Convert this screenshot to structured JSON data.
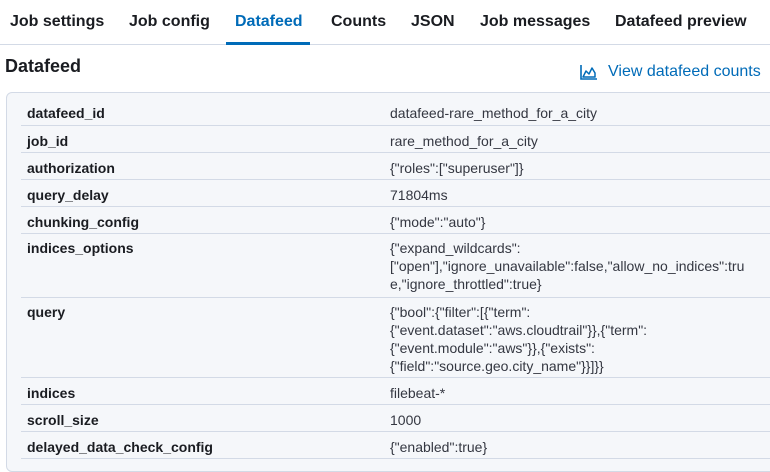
{
  "tabs": [
    {
      "label": "Job settings"
    },
    {
      "label": "Job config"
    },
    {
      "label": "Datafeed"
    },
    {
      "label": "Counts"
    },
    {
      "label": "JSON"
    },
    {
      "label": "Job messages"
    },
    {
      "label": "Datafeed preview"
    }
  ],
  "active_tab": "Datafeed",
  "section": {
    "title": "Datafeed",
    "counts_link": "View datafeed counts",
    "counts_icon": "chart-area-icon"
  },
  "colors": {
    "accent": "#006bb8",
    "panel_bg": "#f5f7fa",
    "border": "#d3dae6"
  },
  "rows": [
    {
      "key": "datafeed_id",
      "value": "datafeed-rare_method_for_a_city"
    },
    {
      "key": "job_id",
      "value": "rare_method_for_a_city"
    },
    {
      "key": "authorization",
      "value": "{\"roles\":[\"superuser\"]}"
    },
    {
      "key": "query_delay",
      "value": "71804ms"
    },
    {
      "key": "chunking_config",
      "value": "{\"mode\":\"auto\"}"
    },
    {
      "key": "indices_options",
      "value": "{\"expand_wildcards\":\n[\"open\"],\"ignore_unavailable\":false,\"allow_no_indices\":tru\ne,\"ignore_throttled\":true}"
    },
    {
      "key": "query",
      "value": "{\"bool\":{\"filter\":[{\"term\":\n{\"event.dataset\":\"aws.cloudtrail\"}},{\"term\":\n{\"event.module\":\"aws\"}},{\"exists\":\n{\"field\":\"source.geo.city_name\"}}]}}"
    },
    {
      "key": "indices",
      "value": "filebeat-*"
    },
    {
      "key": "scroll_size",
      "value": "1000"
    },
    {
      "key": "delayed_data_check_config",
      "value": "{\"enabled\":true}"
    }
  ]
}
